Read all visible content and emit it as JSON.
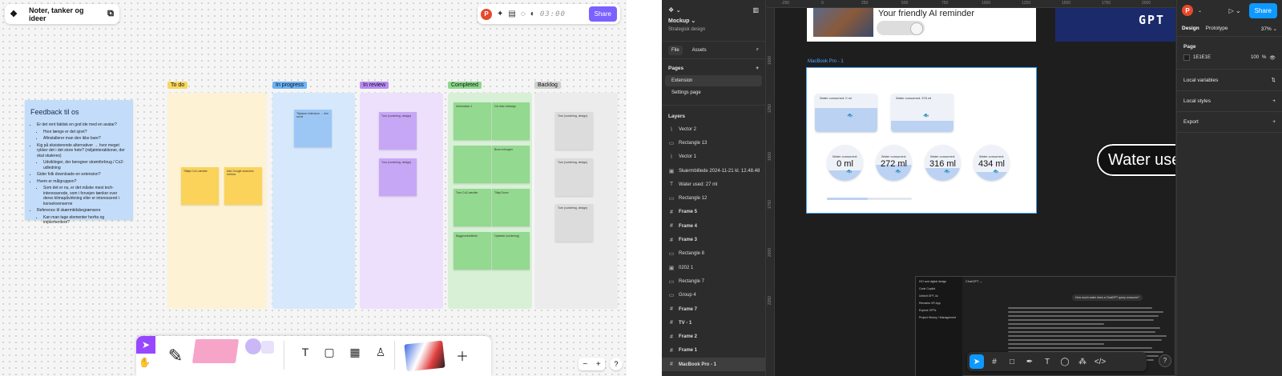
{
  "figjam": {
    "title": "Noter, tanker og ideer",
    "avatar_letter": "P",
    "timer": "03:00",
    "share_label": "Share",
    "feedback_card": {
      "title": "Feedback til os",
      "items": [
        {
          "text": "Er det rent faktisk en god ide med en avatar?",
          "sub": false
        },
        {
          "text": "Hvor længe er det sjovt?",
          "sub": true
        },
        {
          "text": "Afinstallerer man den ikke bare?",
          "sub": true
        },
        {
          "text": "Kig på eksisterende alternativer → hvor meget rykker det i det store hele? (miljøinteraktioner, der skal skaleres)",
          "sub": false
        },
        {
          "text": "Udviklinger, der beregner strømforbrug / Co2-udledning",
          "sub": true
        },
        {
          "text": "Gider folk downloade en extension?",
          "sub": false
        },
        {
          "text": "Hvem er målgruppen?",
          "sub": false
        },
        {
          "text": "Som det er nu, er det måske mest tech-interesserede, som i forvejen tænker over deres klimapåvirkning eller er interesseret i konsekvenserne",
          "sub": true
        },
        {
          "text": "Reference til skærmtidsbegrænsere",
          "sub": false
        },
        {
          "text": "Kan man tage elementer herfra og implementere?",
          "sub": true
        }
      ]
    },
    "columns": [
      {
        "label": "To do",
        "label_color": "#f9d75c",
        "bg": "#fdf2d4"
      },
      {
        "label": "In progress",
        "label_color": "#6cb4f7",
        "bg": "#d6e8fb"
      },
      {
        "label": "In review",
        "label_color": "#b98cf5",
        "bg": "#ece0fc"
      },
      {
        "label": "Completed",
        "label_color": "#8cd98c",
        "bg": "#d8f0d6"
      },
      {
        "label": "Backlog",
        "label_color": "#cfcfcf",
        "bg": "#ececec"
      }
    ],
    "todo_stickies": [
      "Tilføje Co2-værdier",
      "Add Google searches metrics"
    ],
    "progress_stickies": [
      "Tilpasse extension → den scroll"
    ],
    "review_stickies": [
      "Turn (vurdering, design)",
      "Turn (vurdering, design)"
    ],
    "backlog_stickies": [
      "Turn (vurdering, design)",
      "Turn (vurdering, design)",
      "Turn (vurdering, design)"
    ],
    "completed_stickies": [
      "Information 1",
      "Giv ikke redesign",
      "",
      "Brum mirrogen",
      "Turn Co2-værdier",
      "Tilføj Score",
      "Baggrundsbillede",
      "Oplæste (vurdering)"
    ]
  },
  "figma": {
    "file_name": "Mockup",
    "project": "Strategisk design",
    "tabs": {
      "file": "File",
      "assets": "Assets"
    },
    "pages_label": "Pages",
    "pages": [
      "Extension",
      "Settings page"
    ],
    "layers_label": "Layers",
    "layers": [
      {
        "name": "Vector 2",
        "type": "vector"
      },
      {
        "name": "Rectangle 13",
        "type": "rect"
      },
      {
        "name": "Vector 1",
        "type": "vector"
      },
      {
        "name": "Skærmbillede 2024-11-21 kl. 12.48.48",
        "type": "image"
      },
      {
        "name": "Water used: 27 ml",
        "type": "text"
      },
      {
        "name": "Rectangle 12",
        "type": "rect"
      },
      {
        "name": "Frame 5",
        "type": "frame"
      },
      {
        "name": "Frame 4",
        "type": "frame"
      },
      {
        "name": "Frame 3",
        "type": "frame"
      },
      {
        "name": "Rectangle 8",
        "type": "rect"
      },
      {
        "name": "0202 1",
        "type": "image"
      },
      {
        "name": "Rectangle 7",
        "type": "rect"
      },
      {
        "name": "Group 4",
        "type": "rect"
      },
      {
        "name": "Frame 7",
        "type": "frame"
      },
      {
        "name": "TV - 1",
        "type": "frame"
      },
      {
        "name": "Frame 2",
        "type": "frame"
      },
      {
        "name": "Frame 1",
        "type": "frame"
      },
      {
        "name": "MacBook Pro - 1",
        "type": "frame"
      }
    ],
    "ruler_top": [
      "-250",
      "0",
      "250",
      "500",
      "750",
      "1000",
      "1250",
      "1500",
      "1750",
      "2000"
    ],
    "ruler_left": [
      "1000",
      "1250",
      "1500",
      "1750",
      "2000",
      "2250"
    ],
    "top_frame_text": "Your friendly AI reminder",
    "gpt_text": "GPT",
    "macbook_label": "MacBook Pro - 1",
    "water_cards": [
      {
        "label": "Water consumed: 0 ml",
        "fill": 0.62
      },
      {
        "label": "Water consumed: 376 ml",
        "fill": 0.3
      }
    ],
    "water_circles": [
      {
        "label": "Water consumed:",
        "value": "0 ml",
        "fill": 0.3
      },
      {
        "label": "Water consumed:",
        "value": "272 ml",
        "fill": 0.45
      },
      {
        "label": "Water consumed:",
        "value": "316 ml",
        "fill": 0.35
      },
      {
        "label": "Water consumed:",
        "value": "434 ml",
        "fill": 0.25
      }
    ],
    "progress_fraction": 0.48,
    "pill_text": "Water used",
    "chat": {
      "title": "ChatGPT",
      "side_items": [
        "HCI and digital design",
        "Code Copilot",
        "Unlimit GPT-4o",
        "Remarks VR App",
        "Explore GPTs",
        "Project History / Management"
      ],
      "question": "How much water does a ChatGPT query consume?"
    },
    "right_panel": {
      "avatar_letter": "P",
      "share_label": "Share",
      "tab_design": "Design",
      "tab_prototype": "Prototype",
      "zoom": "37%",
      "page_label": "Page",
      "page_color": "1E1E1E",
      "page_opacity": "100",
      "page_opacity_unit": "%",
      "local_variables": "Local variables",
      "local_styles": "Local styles",
      "export": "Export"
    }
  }
}
